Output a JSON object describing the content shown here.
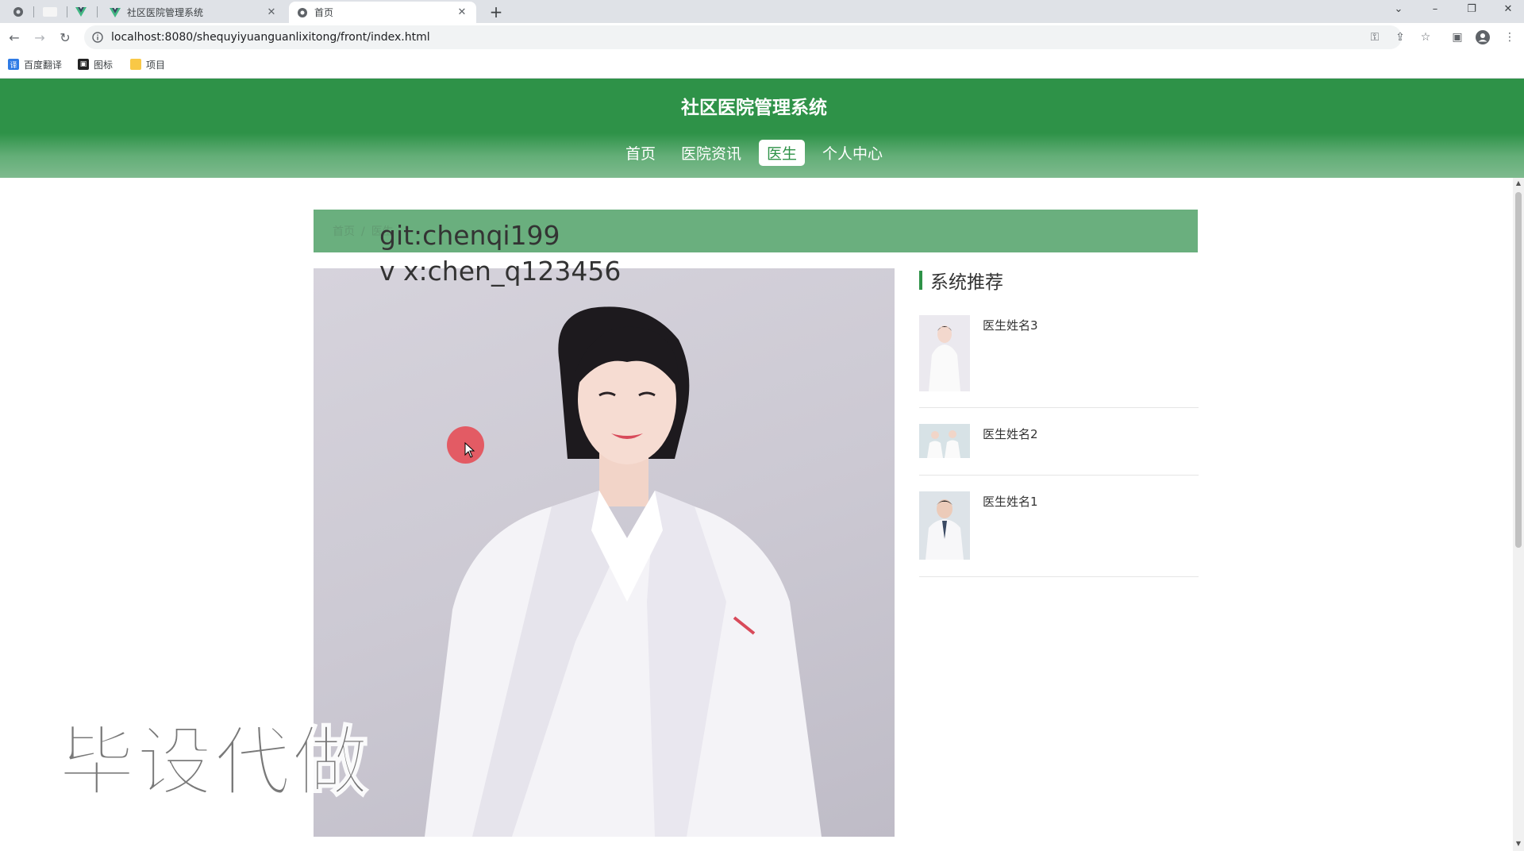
{
  "browser": {
    "tabs": [
      {
        "title": "社区医院管理系统",
        "close": "✕"
      },
      {
        "title": "首页",
        "close": "✕"
      }
    ],
    "new_tab": "+",
    "url": "localhost:8080/shequyiyuanguanlixitong/front/index.html",
    "bookmarks": [
      {
        "label": "百度翻译"
      },
      {
        "label": "图标"
      },
      {
        "label": "项目"
      }
    ]
  },
  "site": {
    "title": "社区医院管理系统",
    "nav": [
      "首页",
      "医院资讯",
      "医生",
      "个人中心"
    ],
    "active_nav": "医生",
    "accent_color": "#2e9248"
  },
  "breadcrumb": [
    "首页",
    "医生"
  ],
  "sidebar": {
    "title": "系统推荐",
    "items": [
      {
        "name": "医生姓名3"
      },
      {
        "name": "医生姓名2"
      },
      {
        "name": "医生姓名1"
      }
    ]
  },
  "overlay": {
    "git": "git:chenqi199",
    "wx": "v x:chen_q123456",
    "big": "毕设代做"
  }
}
